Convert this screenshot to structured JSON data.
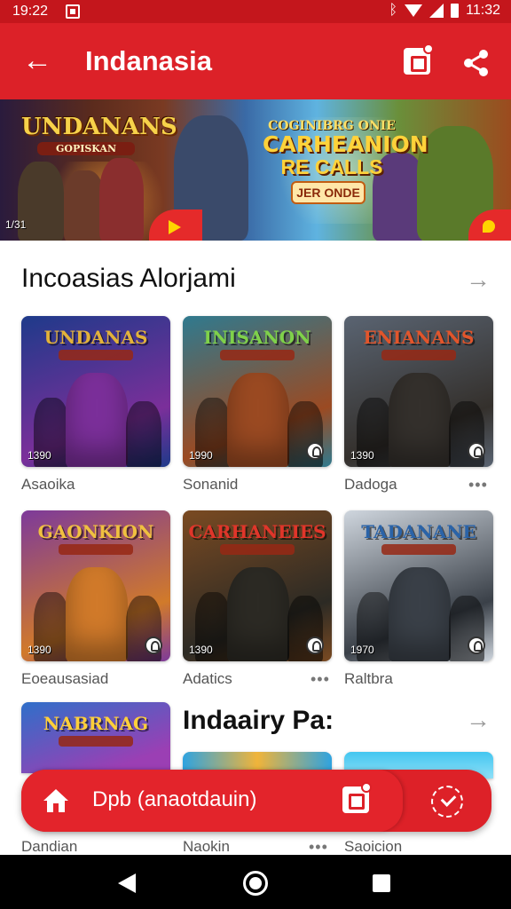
{
  "status_bar": {
    "time": "19:22",
    "battery_text": "11:32"
  },
  "app_bar": {
    "title": "Indanasia",
    "icons": [
      "back-arrow-icon",
      "badge-square-icon",
      "share-icon"
    ]
  },
  "banner": {
    "logo_title": "UNDANANS",
    "logo_subtitle": "GOPISKAN",
    "headline_top": "COGINIBRG ONIE",
    "headline_main": "CARHEANION",
    "headline_sub": "RE CALLS",
    "cta": "JER ONDE",
    "counter": "1/31"
  },
  "section1": {
    "title": "Incoasias Alorjami",
    "tiles_row1": [
      {
        "title": "UNDANAS",
        "count": "1390",
        "caption": "Asaoika",
        "palette": [
          "#1e3a8a",
          "#7b2f9a",
          "#e2b23a"
        ]
      },
      {
        "title": "INISANON",
        "count": "1990",
        "caption": "Sonanid",
        "palette": [
          "#2f7a8f",
          "#9b4a22",
          "#7fd14a"
        ]
      },
      {
        "title": "ENIANANS",
        "count": "1390",
        "caption": "Dadoga",
        "palette": [
          "#5a6472",
          "#34302c",
          "#e2552b"
        ]
      }
    ],
    "tiles_row2": [
      {
        "title": "GAONKION",
        "count": "1390",
        "caption": "Eoeausasiad",
        "palette": [
          "#7d3a9a",
          "#d17a2a",
          "#f0c040"
        ]
      },
      {
        "title": "CARHANEIES",
        "count": "1390",
        "caption": "Adatics",
        "palette": [
          "#7a4a22",
          "#2c2a24",
          "#e0352a"
        ]
      },
      {
        "title": "TADANANE",
        "count": "1970",
        "caption": "Raltbra",
        "palette": [
          "#cfd6de",
          "#3a4048",
          "#2a63a8"
        ]
      }
    ]
  },
  "section2": {
    "title": "Indaairy Pa:",
    "tile1": {
      "title": "NABRNAG",
      "palette": [
        "#2f6fc9",
        "#9b3fb4",
        "#f3c94a"
      ]
    },
    "captions": [
      "Dandian",
      "Naokin",
      "Saoicion"
    ]
  },
  "floating_bar": {
    "label": "Dpb (anaotdauin)"
  },
  "colors": {
    "primary": "#dc2128",
    "statusbar": "#c4161c",
    "navbar": "#000000"
  }
}
